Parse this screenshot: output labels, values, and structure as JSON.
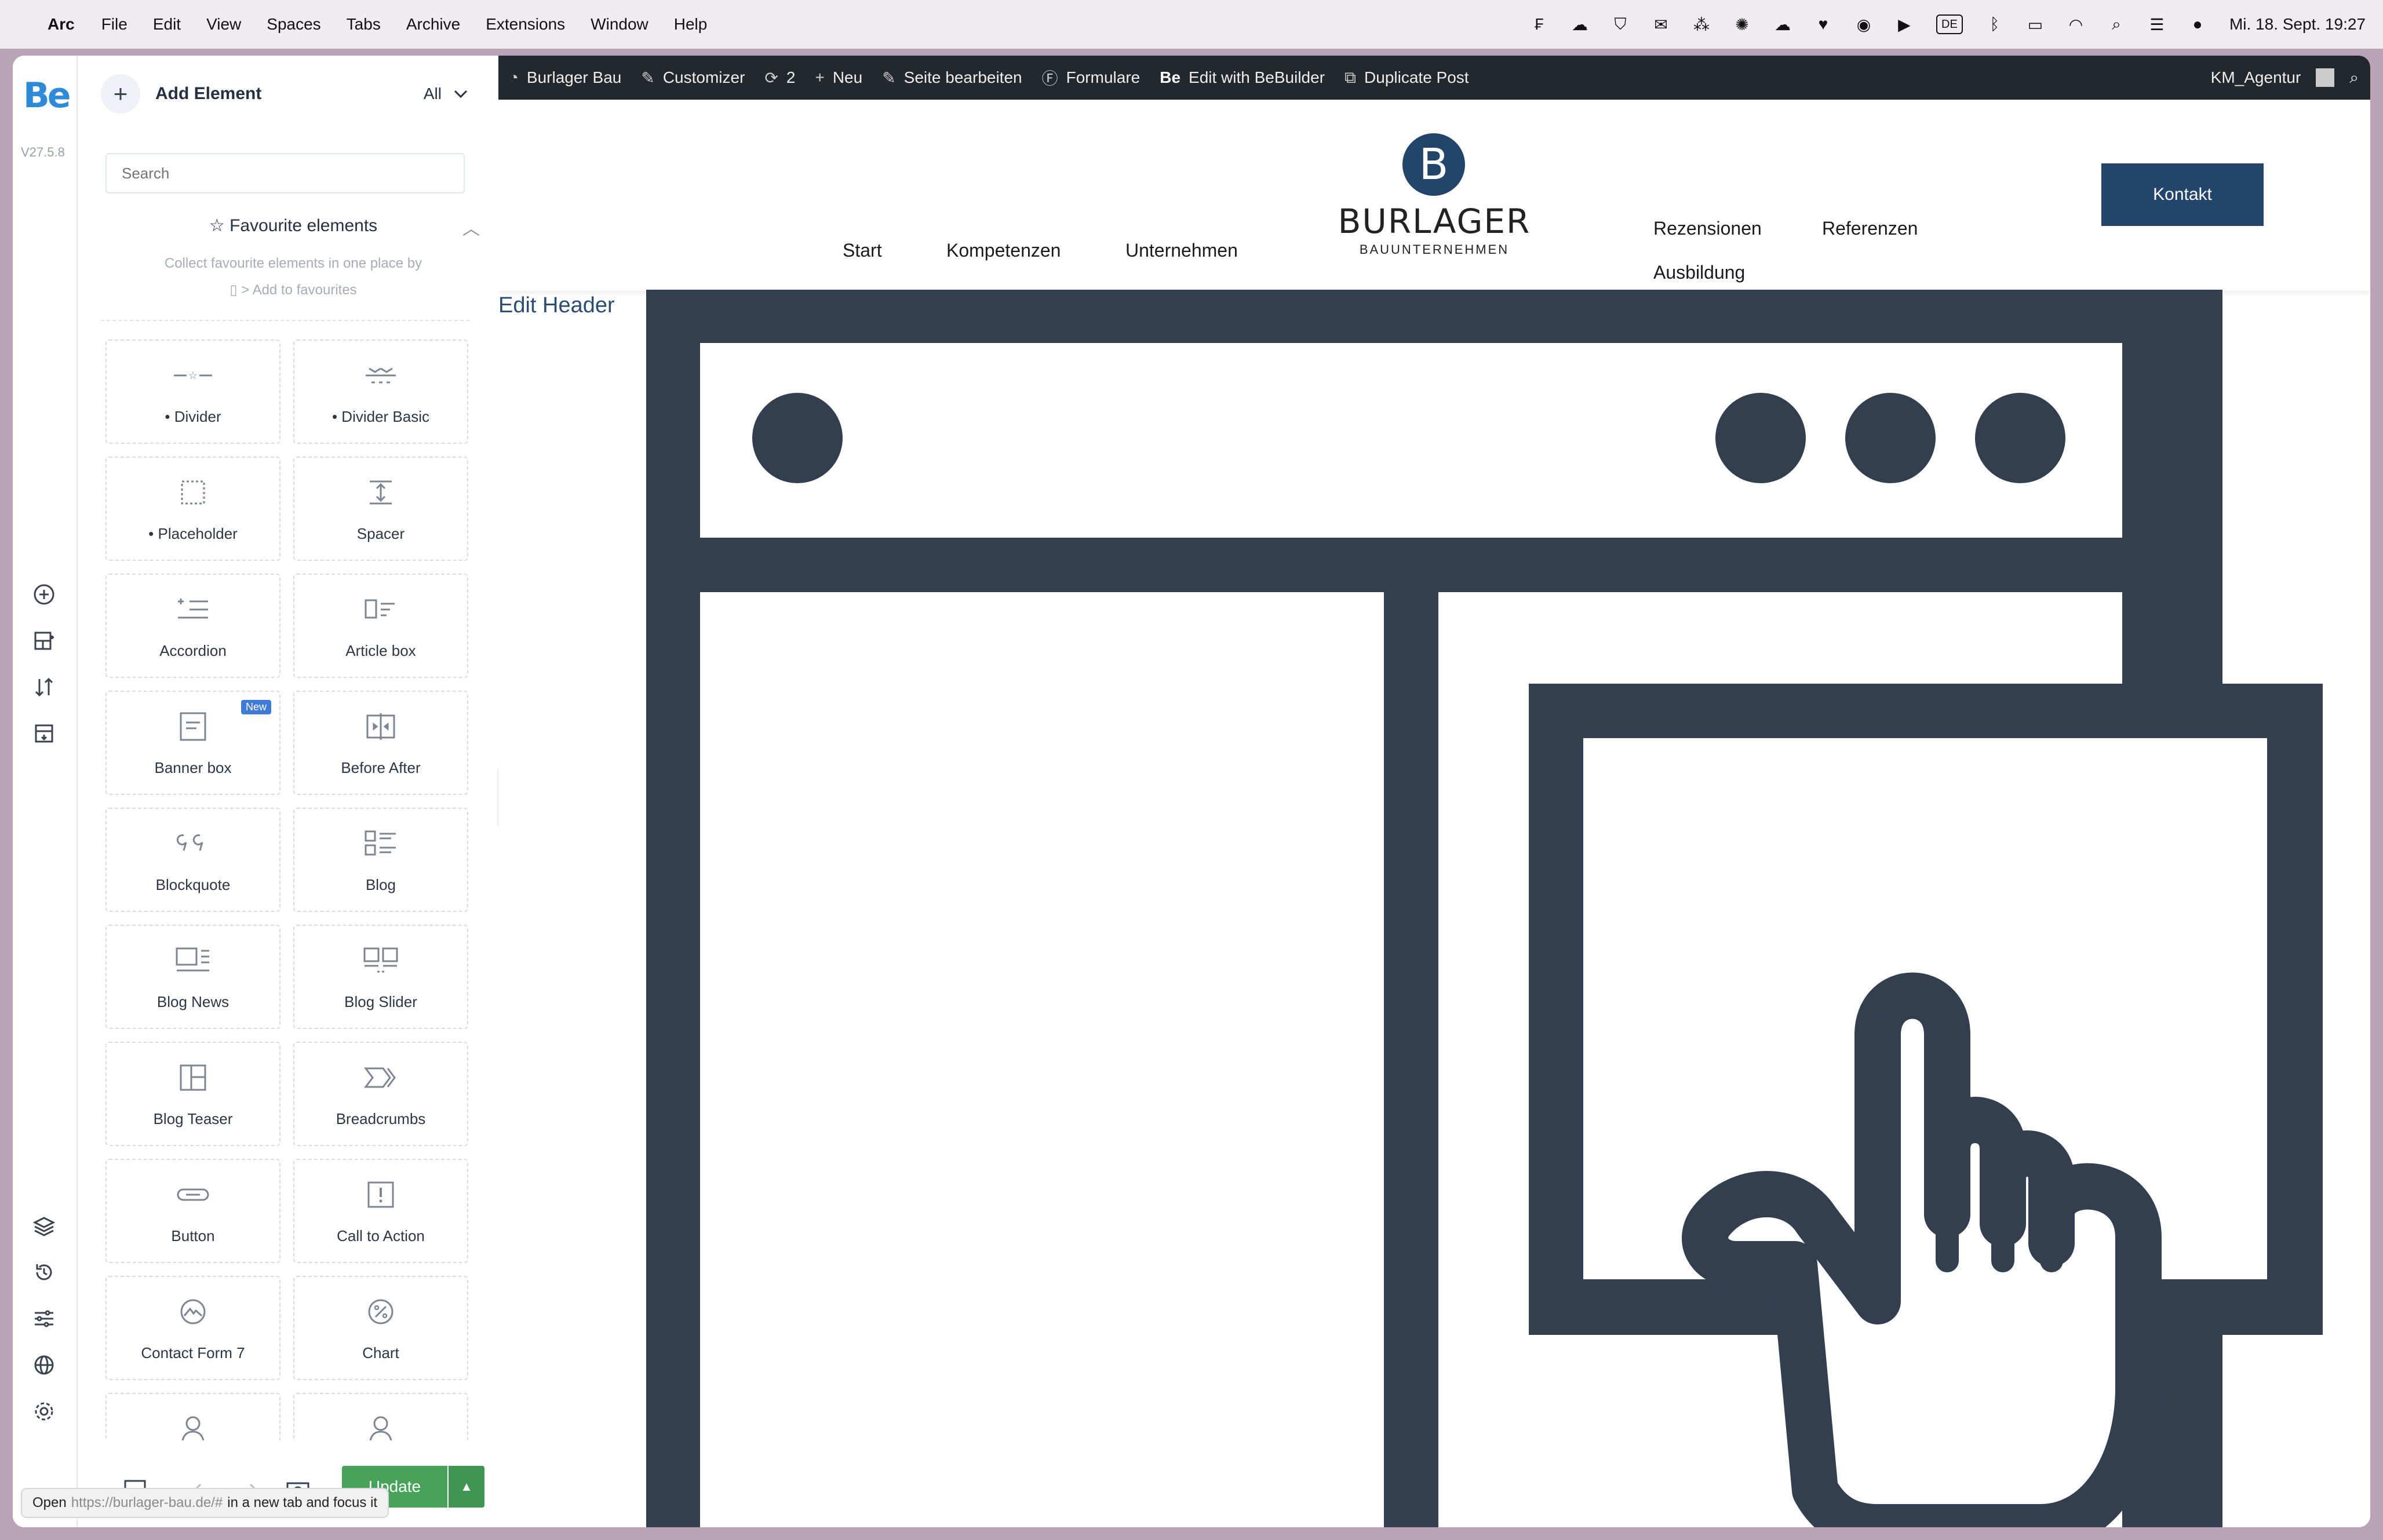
{
  "menubar": {
    "app_name": "Arc",
    "menus": [
      "File",
      "Edit",
      "View",
      "Spaces",
      "Tabs",
      "Archive",
      "Extensions",
      "Window",
      "Help"
    ],
    "input_source": "DE",
    "datetime": "Mi. 18. Sept.  19:27"
  },
  "rail": {
    "logo": "Be",
    "version": "V27.5.8"
  },
  "panel": {
    "title": "Add Element",
    "filter_value": "All",
    "search_placeholder": "Search",
    "favourites_title": "Favourite elements",
    "favourites_desc": "Collect favourite elements in one place by",
    "favourites_hint": "> Add to favourites",
    "elements": [
      {
        "label": "• Divider",
        "icon": "divider-icon"
      },
      {
        "label": "• Divider Basic",
        "icon": "divider-basic-icon"
      },
      {
        "label": "• Placeholder",
        "icon": "placeholder-icon"
      },
      {
        "label": "Spacer",
        "icon": "spacer-icon"
      },
      {
        "label": "Accordion",
        "icon": "accordion-icon"
      },
      {
        "label": "Article box",
        "icon": "article-box-icon"
      },
      {
        "label": "Banner box",
        "icon": "banner-box-icon",
        "badge": "New"
      },
      {
        "label": "Before After",
        "icon": "before-after-icon"
      },
      {
        "label": "Blockquote",
        "icon": "blockquote-icon"
      },
      {
        "label": "Blog",
        "icon": "blog-icon"
      },
      {
        "label": "Blog News",
        "icon": "blog-news-icon"
      },
      {
        "label": "Blog Slider",
        "icon": "blog-slider-icon"
      },
      {
        "label": "Blog Teaser",
        "icon": "blog-teaser-icon"
      },
      {
        "label": "Breadcrumbs",
        "icon": "breadcrumbs-icon"
      },
      {
        "label": "Button",
        "icon": "button-icon"
      },
      {
        "label": "Call to Action",
        "icon": "call-to-action-icon"
      },
      {
        "label": "Contact Form 7",
        "icon": "contact-form-icon"
      },
      {
        "label": "Chart",
        "icon": "chart-icon"
      },
      {
        "label": "",
        "icon": "user-icon"
      },
      {
        "label": "",
        "icon": "user-icon"
      }
    ],
    "update_label": "Update",
    "tooltip_prefix": "Open",
    "tooltip_url": "https://burlager-bau.de/#",
    "tooltip_suffix": "in a new tab and focus it"
  },
  "adminbar": {
    "site": "Burlager Bau",
    "customizer": "Customizer",
    "updates_count": "2",
    "new": "Neu",
    "edit_page": "Seite bearbeiten",
    "forms": "Formulare",
    "bebuilder": "Edit with BeBuilder",
    "duplicate": "Duplicate Post",
    "user": "KM_Agentur"
  },
  "site": {
    "nav_left": [
      "Start",
      "Kompetenzen",
      "Unternehmen"
    ],
    "nav_right": [
      "Rezensionen",
      "Referenzen",
      "Ausbildung"
    ],
    "logo_letter": "B",
    "logo_name": "BURLAGER",
    "logo_sub": "BAUUNTERNEHMEN",
    "cta": "Kontakt",
    "edit_header": "Edit Header"
  },
  "colors": {
    "brand_navy": "#24456b",
    "illustration": "#313f4f",
    "update_green": "#47a35a",
    "be_blue": "#2e8bd9"
  }
}
